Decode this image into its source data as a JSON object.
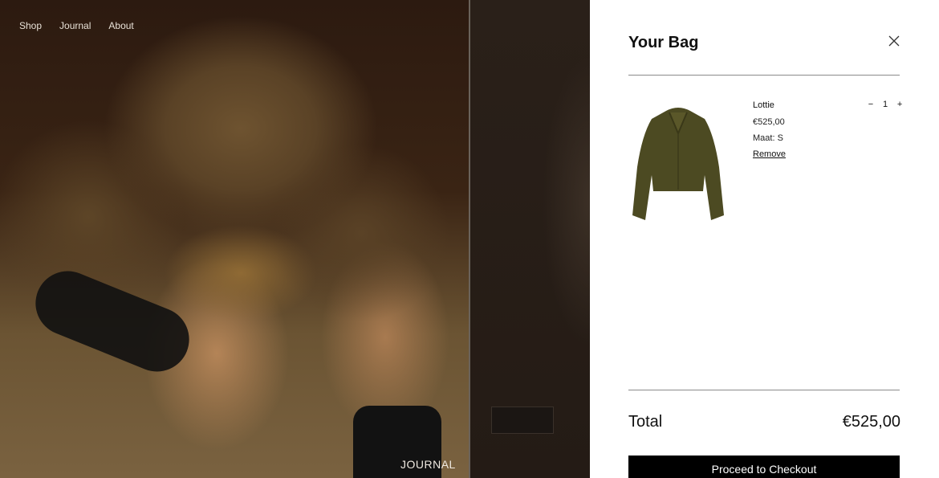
{
  "nav": {
    "items": [
      "Shop",
      "Journal",
      "About"
    ]
  },
  "backdrop": {
    "caption": "JOURNAL"
  },
  "bag": {
    "title": "Your Bag",
    "item": {
      "name": "Lottie",
      "price": "€525,00",
      "size": "Maat: S",
      "remove_label": "Remove",
      "quantity": "1",
      "minus": "−",
      "plus": "+"
    },
    "total_label": "Total",
    "total_value": "€525,00",
    "checkout_label": "Proceed to Checkout"
  },
  "icons": {
    "close": "close-icon",
    "product": "fur-jacket-image"
  },
  "colors": {
    "drawer_bg": "#ffffff",
    "button_bg": "#000000",
    "rule": "#8a8a8a"
  }
}
